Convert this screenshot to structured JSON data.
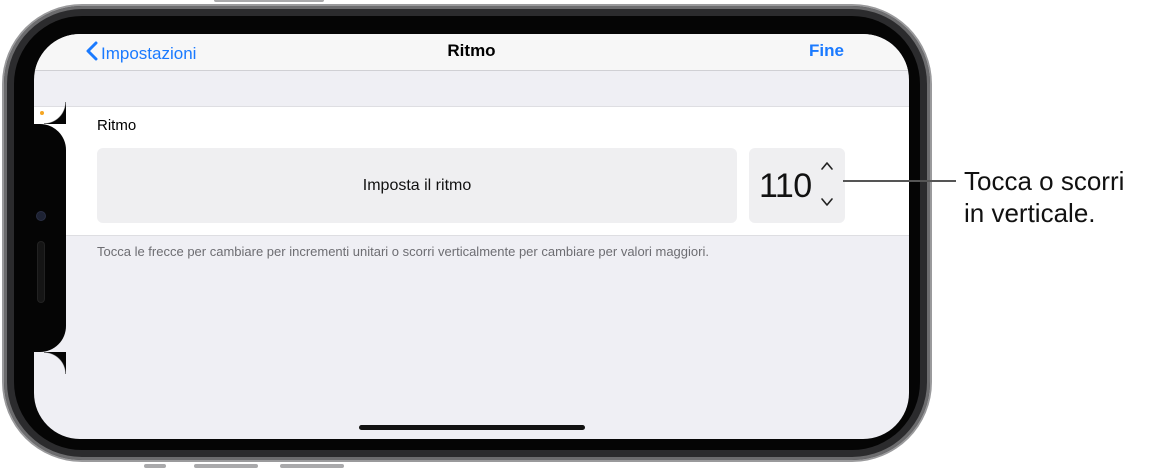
{
  "navbar": {
    "back_label": "Impostazioni",
    "title": "Ritmo",
    "done_label": "Fine"
  },
  "tempo_section": {
    "label": "Ritmo",
    "set_tempo_button": "Imposta il ritmo",
    "stepper_value": "110"
  },
  "hint": "Tocca le frecce per cambiare per incrementi unitari o scorri verticalmente per cambiare per valori maggiori.",
  "callout": {
    "line1": "Tocca o scorri",
    "line2": "in verticale."
  },
  "icons": {
    "back": "chevron-left-icon",
    "increment": "chevron-up-icon",
    "decrement": "chevron-down-icon"
  },
  "colors": {
    "accent": "#1a7aff",
    "background": "#efeff4",
    "control": "#efeff1"
  }
}
